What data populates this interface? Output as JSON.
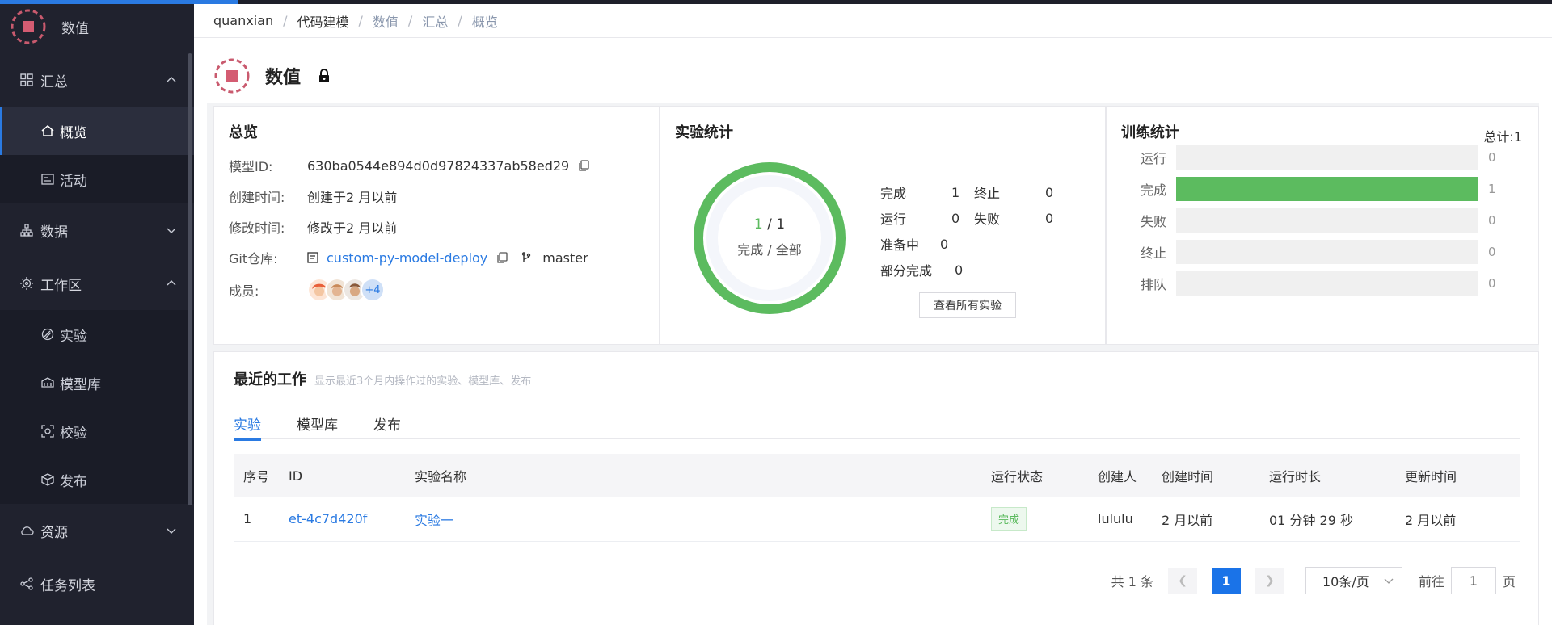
{
  "app": {
    "name": "数值"
  },
  "sidebar": {
    "groups": [
      {
        "label": "汇总",
        "items": [
          {
            "label": "概览"
          },
          {
            "label": "活动"
          }
        ]
      },
      {
        "label": "数据"
      },
      {
        "label": "工作区",
        "items": [
          {
            "label": "实验"
          },
          {
            "label": "模型库"
          },
          {
            "label": "校验"
          },
          {
            "label": "发布"
          }
        ]
      },
      {
        "label": "资源"
      },
      {
        "label": "任务列表"
      }
    ]
  },
  "breadcrumb": [
    "quanxian",
    "代码建模",
    "数值",
    "汇总",
    "概览"
  ],
  "page": {
    "title": "数值"
  },
  "overview": {
    "title": "总览",
    "model_id_label": "模型ID:",
    "model_id": "630ba0544e894d0d97824337ab58ed29",
    "created_label": "创建时间:",
    "created": "创建于2 月以前",
    "modified_label": "修改时间:",
    "modified": "修改于2 月以前",
    "git_label": "Git仓库:",
    "git_repo": "custom-py-model-deploy",
    "git_branch": "master",
    "members_label": "成员:",
    "members_more": "+4",
    "member_colors": [
      "#e8603a",
      "#c98a5a",
      "#8a5a3a"
    ]
  },
  "experiment_stats": {
    "title": "实验统计",
    "completed": "1",
    "total": "1",
    "sep": " / ",
    "caption": "完成 / 全部",
    "progress": 1.0,
    "stats": {
      "done_label": "完成",
      "done": "1",
      "stopped_label": "终止",
      "stopped": "0",
      "running_label": "运行",
      "running": "0",
      "failed_label": "失败",
      "failed": "0",
      "preparing_label": "准备中",
      "preparing": "0",
      "partial_label": "部分完成",
      "partial": "0"
    },
    "view_all": "查看所有实验"
  },
  "training_stats": {
    "title": "训练统计",
    "total": "总计:1",
    "max": 1,
    "bars": [
      {
        "label": "运行",
        "value": 0
      },
      {
        "label": "完成",
        "value": 1
      },
      {
        "label": "失败",
        "value": 0
      },
      {
        "label": "终止",
        "value": 0
      },
      {
        "label": "排队",
        "value": 0
      }
    ],
    "bar_color": "#5cbb5f"
  },
  "recent": {
    "title": "最近的工作",
    "subtitle": "显示最近3个月内操作过的实验、模型库、发布",
    "tabs": [
      "实验",
      "模型库",
      "发布"
    ],
    "columns": [
      "序号",
      "ID",
      "实验名称",
      "运行状态",
      "创建人",
      "创建时间",
      "运行时长",
      "更新时间"
    ],
    "rows": [
      {
        "index": "1",
        "id": "et-4c7d420f",
        "name": "实验一",
        "status": "完成",
        "creator": "lululu",
        "created": "2 月以前",
        "duration": "01 分钟 29 秒",
        "updated": "2 月以前"
      }
    ]
  },
  "pagination": {
    "total_text": "共 1 条",
    "current": "1",
    "page_size": "10条/页",
    "goto_label": "前往",
    "goto_value": "1",
    "goto_suffix": "页"
  },
  "colors": {
    "accent": "#2a7ae2",
    "success": "#5cbb5f",
    "sidebar_bg": "#20222e"
  }
}
